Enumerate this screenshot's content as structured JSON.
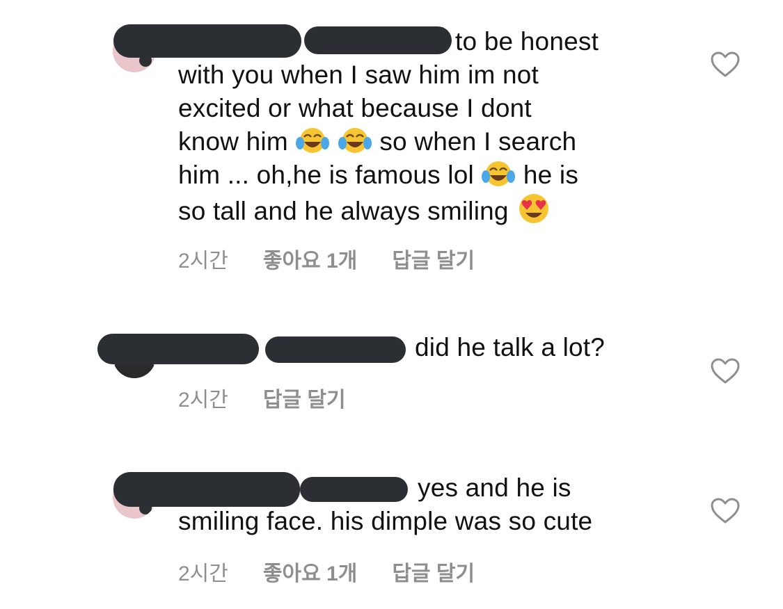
{
  "comments": [
    {
      "text_line1": "to be honest",
      "text_lines": [
        "with you when I saw him im not",
        "excited or what because I dont",
        "know him",
        "so when I search",
        "him ... oh,he is famous lol",
        "he is",
        "so tall and he always smiling"
      ],
      "time": "2시간",
      "likes": "좋아요 1개",
      "reply": "답글 달기",
      "emoji": [
        "laughing-tears-emoji",
        "heart-eyes-emoji"
      ]
    },
    {
      "text_line1": "did he talk a lot?",
      "time": "2시간",
      "reply": "답글 달기"
    },
    {
      "text_line1": "yes and he is",
      "text_lines": [
        "smiling face. his dimple was so cute"
      ],
      "time": "2시간",
      "likes": "좋아요 1개",
      "reply": "답글 달기"
    }
  ],
  "colors": {
    "text": "#111111",
    "meta": "#8e8e8e",
    "redaction": "#2b2f33",
    "heart_outline": "#8e8e8e"
  },
  "icons": [
    "heart-outline-icon",
    "avatar"
  ]
}
